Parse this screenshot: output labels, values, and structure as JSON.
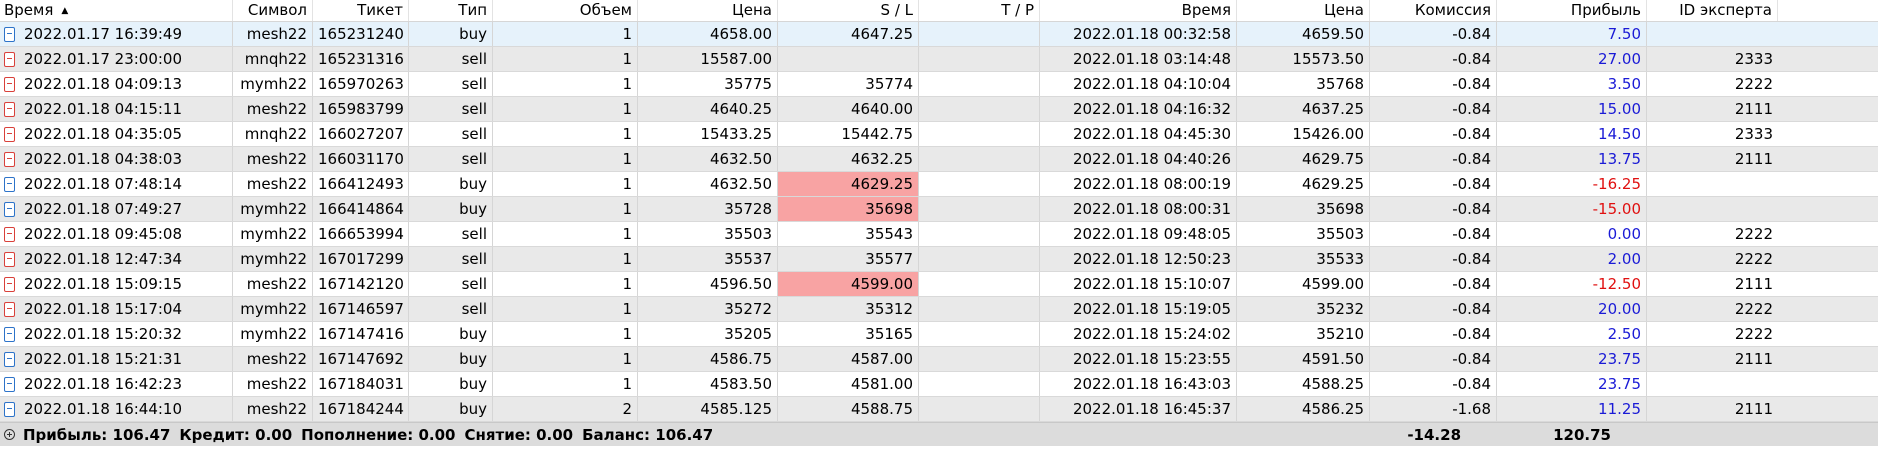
{
  "columns": [
    "Время",
    "Символ",
    "Тикет",
    "Тип",
    "Объем",
    "Цена",
    "S / L",
    "T / P",
    "Время",
    "Цена",
    "Комиссия",
    "Прибыль",
    "ID эксперта"
  ],
  "rows": [
    {
      "open_time": "2022.01.17 16:39:49",
      "symbol": "mesh22",
      "ticket": "165231240",
      "type": "buy",
      "volume": "1",
      "price": "4658.00",
      "sl": "4647.25",
      "tp": "",
      "close_time": "2022.01.18 00:32:58",
      "close_price": "4659.50",
      "commission": "-0.84",
      "profit": "7.50",
      "expert_id": ""
    },
    {
      "open_time": "2022.01.17 23:00:00",
      "symbol": "mnqh22",
      "ticket": "165231316",
      "type": "sell",
      "volume": "1",
      "price": "15587.00",
      "sl": "",
      "tp": "",
      "close_time": "2022.01.18 03:14:48",
      "close_price": "15573.50",
      "commission": "-0.84",
      "profit": "27.00",
      "expert_id": "2333"
    },
    {
      "open_time": "2022.01.18 04:09:13",
      "symbol": "mymh22",
      "ticket": "165970263",
      "type": "sell",
      "volume": "1",
      "price": "35775",
      "sl": "35774",
      "tp": "",
      "close_time": "2022.01.18 04:10:04",
      "close_price": "35768",
      "commission": "-0.84",
      "profit": "3.50",
      "expert_id": "2222"
    },
    {
      "open_time": "2022.01.18 04:15:11",
      "symbol": "mesh22",
      "ticket": "165983799",
      "type": "sell",
      "volume": "1",
      "price": "4640.25",
      "sl": "4640.00",
      "tp": "",
      "close_time": "2022.01.18 04:16:32",
      "close_price": "4637.25",
      "commission": "-0.84",
      "profit": "15.00",
      "expert_id": "2111"
    },
    {
      "open_time": "2022.01.18 04:35:05",
      "symbol": "mnqh22",
      "ticket": "166027207",
      "type": "sell",
      "volume": "1",
      "price": "15433.25",
      "sl": "15442.75",
      "tp": "",
      "close_time": "2022.01.18 04:45:30",
      "close_price": "15426.00",
      "commission": "-0.84",
      "profit": "14.50",
      "expert_id": "2333"
    },
    {
      "open_time": "2022.01.18 04:38:03",
      "symbol": "mesh22",
      "ticket": "166031170",
      "type": "sell",
      "volume": "1",
      "price": "4632.50",
      "sl": "4632.25",
      "tp": "",
      "close_time": "2022.01.18 04:40:26",
      "close_price": "4629.75",
      "commission": "-0.84",
      "profit": "13.75",
      "expert_id": "2111"
    },
    {
      "open_time": "2022.01.18 07:48:14",
      "symbol": "mesh22",
      "ticket": "166412493",
      "type": "buy",
      "volume": "1",
      "price": "4632.50",
      "sl": "4629.25",
      "tp": "",
      "close_time": "2022.01.18 08:00:19",
      "close_price": "4629.25",
      "commission": "-0.84",
      "profit": "-16.25",
      "expert_id": "",
      "sl_hit": true
    },
    {
      "open_time": "2022.01.18 07:49:27",
      "symbol": "mymh22",
      "ticket": "166414864",
      "type": "buy",
      "volume": "1",
      "price": "35728",
      "sl": "35698",
      "tp": "",
      "close_time": "2022.01.18 08:00:31",
      "close_price": "35698",
      "commission": "-0.84",
      "profit": "-15.00",
      "expert_id": "",
      "sl_hit": true
    },
    {
      "open_time": "2022.01.18 09:45:08",
      "symbol": "mymh22",
      "ticket": "166653994",
      "type": "sell",
      "volume": "1",
      "price": "35503",
      "sl": "35543",
      "tp": "",
      "close_time": "2022.01.18 09:48:05",
      "close_price": "35503",
      "commission": "-0.84",
      "profit": "0.00",
      "expert_id": "2222"
    },
    {
      "open_time": "2022.01.18 12:47:34",
      "symbol": "mymh22",
      "ticket": "167017299",
      "type": "sell",
      "volume": "1",
      "price": "35537",
      "sl": "35577",
      "tp": "",
      "close_time": "2022.01.18 12:50:23",
      "close_price": "35533",
      "commission": "-0.84",
      "profit": "2.00",
      "expert_id": "2222"
    },
    {
      "open_time": "2022.01.18 15:09:15",
      "symbol": "mesh22",
      "ticket": "167142120",
      "type": "sell",
      "volume": "1",
      "price": "4596.50",
      "sl": "4599.00",
      "tp": "",
      "close_time": "2022.01.18 15:10:07",
      "close_price": "4599.00",
      "commission": "-0.84",
      "profit": "-12.50",
      "expert_id": "2111",
      "sl_hit": true
    },
    {
      "open_time": "2022.01.18 15:17:04",
      "symbol": "mymh22",
      "ticket": "167146597",
      "type": "sell",
      "volume": "1",
      "price": "35272",
      "sl": "35312",
      "tp": "",
      "close_time": "2022.01.18 15:19:05",
      "close_price": "35232",
      "commission": "-0.84",
      "profit": "20.00",
      "expert_id": "2222"
    },
    {
      "open_time": "2022.01.18 15:20:32",
      "symbol": "mymh22",
      "ticket": "167147416",
      "type": "buy",
      "volume": "1",
      "price": "35205",
      "sl": "35165",
      "tp": "",
      "close_time": "2022.01.18 15:24:02",
      "close_price": "35210",
      "commission": "-0.84",
      "profit": "2.50",
      "expert_id": "2222"
    },
    {
      "open_time": "2022.01.18 15:21:31",
      "symbol": "mesh22",
      "ticket": "167147692",
      "type": "buy",
      "volume": "1",
      "price": "4586.75",
      "sl": "4587.00",
      "tp": "",
      "close_time": "2022.01.18 15:23:55",
      "close_price": "4591.50",
      "commission": "-0.84",
      "profit": "23.75",
      "expert_id": "2111"
    },
    {
      "open_time": "2022.01.18 16:42:23",
      "symbol": "mesh22",
      "ticket": "167184031",
      "type": "buy",
      "volume": "1",
      "price": "4583.50",
      "sl": "4581.00",
      "tp": "",
      "close_time": "2022.01.18 16:43:03",
      "close_price": "4588.25",
      "commission": "-0.84",
      "profit": "23.75",
      "expert_id": ""
    },
    {
      "open_time": "2022.01.18 16:44:10",
      "symbol": "mesh22",
      "ticket": "167184244",
      "type": "buy",
      "volume": "2",
      "price": "4585.125",
      "sl": "4588.75",
      "tp": "",
      "close_time": "2022.01.18 16:45:37",
      "close_price": "4586.25",
      "commission": "-1.68",
      "profit": "11.25",
      "expert_id": "2111"
    }
  ],
  "footer": {
    "profit": "Прибыль: 106.47",
    "credit": "Кредит: 0.00",
    "deposit": "Пополнение: 0.00",
    "withdrawal": "Снятие: 0.00",
    "balance": "Баланс: 106.47",
    "total_commission": "-14.28",
    "total_profit": "120.75"
  },
  "colors": {
    "buy_icon": "#2d73c9",
    "sell_icon": "#d9403a",
    "positive_profit": "#1a1ad6",
    "negative_profit": "#e01010",
    "sl_hit_highlight": "#f8a3a3",
    "selected_row": "#e6f2fb",
    "stripe_row": "#e9e9e9"
  },
  "icons": {
    "buy": "buy-deal-icon",
    "sell": "sell-deal-icon",
    "sort": "sort-ascending-icon",
    "expand": "expand-plus-icon"
  }
}
